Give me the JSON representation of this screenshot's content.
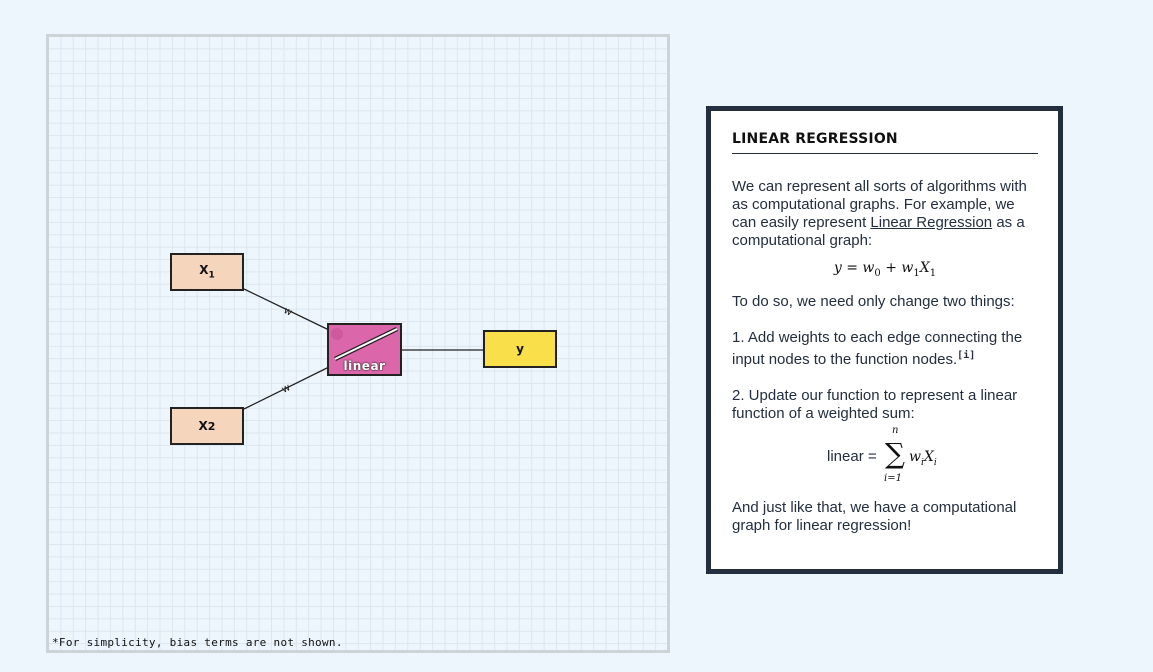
{
  "diagram": {
    "nodes": {
      "x1": {
        "label": "x1",
        "main": "X",
        "sub": "1"
      },
      "x2": {
        "label": "x2",
        "main": "X",
        "sub": "2"
      },
      "func": {
        "label": "linear"
      },
      "y": {
        "label": "y"
      }
    },
    "edge_labels": {
      "w_top": "w",
      "w_bottom": "w"
    },
    "footnote": "*For simplicity, bias terms are not shown."
  },
  "panel": {
    "title": "LINEAR REGRESSION",
    "p1_before": "We can represent all sorts of algorithms with as computational graphs. For example, we can easily represent ",
    "p1_link": "Linear Regression",
    "p1_after": " as a computational graph:",
    "eq1": {
      "y": "y",
      "eq": " = ",
      "w0": "w",
      "w0_sub": "0",
      "plus": " + ",
      "w1": "w",
      "w1_sub": "1",
      "X1": "X",
      "X1_sub": "1"
    },
    "p2": "To do so, we need only change two things:",
    "p3": "1. Add weights to each edge connecting the input nodes to the function nodes.",
    "p3_sup": "[i]",
    "p4": "2. Update our function to represent a linear function of a weighted sum:",
    "eq2": {
      "lhs": "linear = ",
      "top": "n",
      "bottom": "i=1",
      "w": "w",
      "w_sub": "i",
      "X": "X",
      "X_sub": "i"
    },
    "p5": "And just like that, we have a computational graph for linear regression!"
  }
}
